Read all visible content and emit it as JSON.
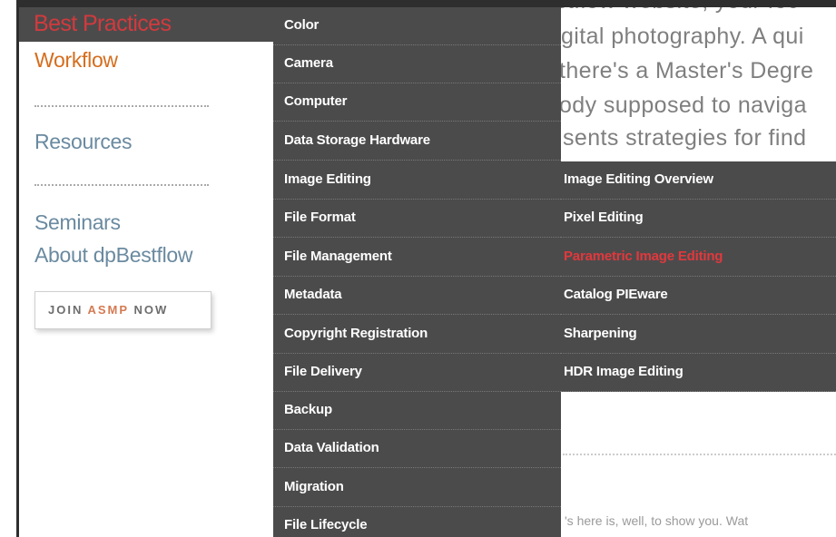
{
  "nav": {
    "best_practices": "Best Practices",
    "workflow": "Workflow",
    "resources": "Resources",
    "seminars": "Seminars",
    "about": "About dpBestflow",
    "join_prefix": "JOIN",
    "join_accent": "ASMP",
    "join_suffix": "NOW"
  },
  "main_menu": [
    "Color",
    "Camera",
    "Computer",
    "Data Storage Hardware",
    "Image Editing",
    "File Format",
    "File Management",
    "Metadata",
    "Copyright Registration",
    "File Delivery",
    "Backup",
    "Data Validation",
    "Migration",
    "File Lifecycle"
  ],
  "sub_menu": [
    "Image Editing Overview",
    "Pixel Editing",
    "Parametric Image Editing",
    "Catalog PIEware",
    "Sharpening",
    "HDR Image Editing"
  ],
  "background_text": {
    "line1": "stflow website, your foc",
    "line2": "gital photography. A qui",
    "line3": "there's a Master's Degre",
    "line4": "ody supposed to naviga",
    "line5": "sents strategies for find",
    "bottom": "'s here is, well, to show you. Wat"
  },
  "colors": {
    "menu_background": "#4c4b4c",
    "active_item": "#e2383c",
    "workflow_link": "#d56d1d",
    "nav_link": "#6a8aa0",
    "join_accent": "#d47a52"
  }
}
